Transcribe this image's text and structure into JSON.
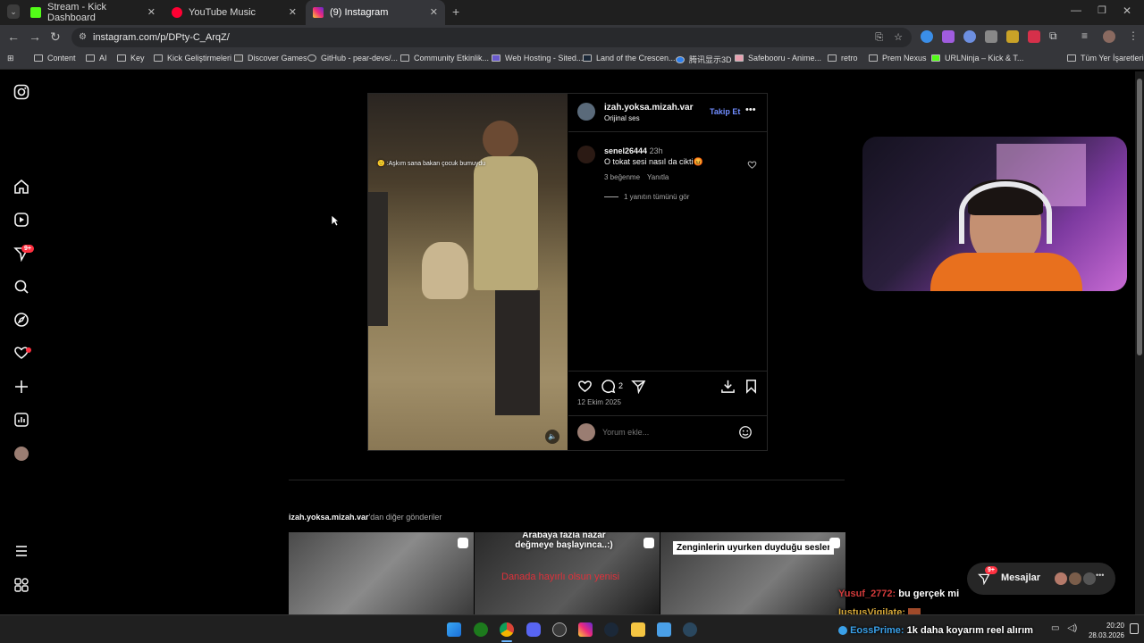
{
  "browser": {
    "tabs": [
      {
        "label": "Stream - Kick Dashboard",
        "icon": "kick-icon",
        "color": "#53fc18"
      },
      {
        "label": "YouTube Music",
        "icon": "youtube-music-icon",
        "color": "#ff0033"
      },
      {
        "label": "(9) Instagram",
        "icon": "instagram-icon",
        "color": "#dd2a7b"
      }
    ],
    "url": "instagram.com/p/DPty-C_ArqZ/",
    "bookmarks": [
      "Content",
      "AI",
      "Key",
      "Kick Geliştirmeleri",
      "Discover Games",
      "GitHub - pear-devs/...",
      "Community Etkinlik...",
      "Web Hosting - Sited...",
      "Land of the Crescen...",
      "腾讯显示3D",
      "Safebooru - Anime...",
      "retro",
      "Prem Nexus",
      "URLNinja – Kick & T..."
    ],
    "bookmarks_all": "Tüm Yer İşaretleri"
  },
  "sidebar": {
    "notification_badge": "9+",
    "items": [
      "instagram-logo",
      "home-icon",
      "reels-icon",
      "messages-icon",
      "search-icon",
      "explore-icon",
      "notifications-icon",
      "create-icon",
      "dashboard-icon",
      "profile-avatar",
      "more-icon",
      "also-from-meta-icon"
    ]
  },
  "post": {
    "author": "izah.yoksa.mizah.var",
    "audio": "Orijinal ses",
    "follow_label": "Takip Et",
    "video_caption": "Aşkım sana bakan çocuk bumuydu",
    "comment": {
      "user": "senel26444",
      "time": "23h",
      "text": "O tokat sesi nasıl da cikti😡",
      "likes": "3 beğenme",
      "reply": "Yanıtla",
      "view_replies": "1 yanıtın tümünü gör"
    },
    "comment_count": "2",
    "date": "12 Ekim 2025",
    "comment_placeholder": "Yorum ekle..."
  },
  "more_posts": {
    "author": "izah.yoksa.mizah.var",
    "suffix": "'dan diğer gönderiler",
    "thumbs": [
      {
        "caption": ""
      },
      {
        "caption": "Arabaya fazla nazar değmeye başlayınca..:)",
        "overlay": "Danada hayırlı olsun yenisi"
      },
      {
        "caption": "Zenginlerin uyurken duyduğu sesler"
      }
    ]
  },
  "messages": {
    "label": "Mesajlar",
    "badge": "9+"
  },
  "chat": [
    {
      "user": "Yusuf_2772:",
      "text": "bu gerçek mi",
      "color": "#d23a3a"
    },
    {
      "user": "IustusVigilate:",
      "text": "",
      "color": "#d6a83a"
    },
    {
      "user": "EossPrime:",
      "text": "1k daha koyarım reel alırım",
      "color": "#3aa0e8"
    }
  ],
  "taskbar": {
    "time": "20:20",
    "date": "28.03.2026"
  }
}
